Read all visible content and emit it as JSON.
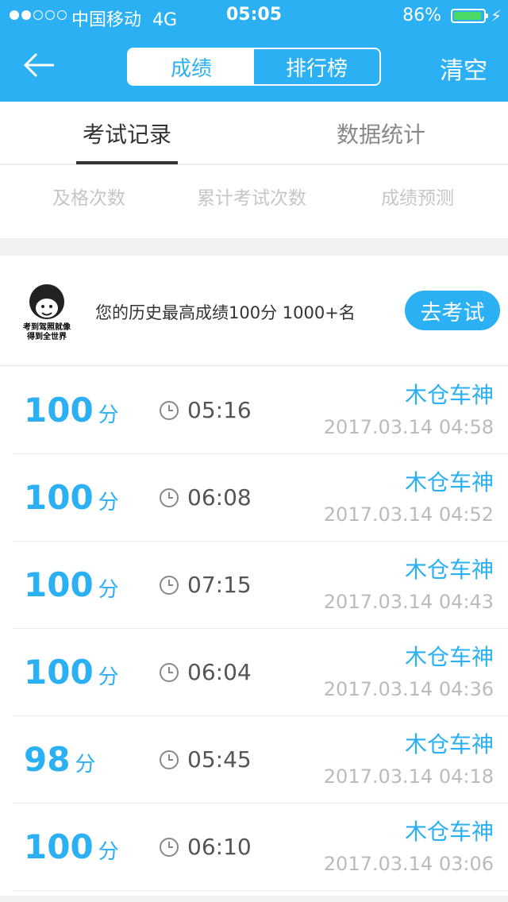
{
  "status_bar": {
    "carrier": "中国移动",
    "network": "4G",
    "time": "05:05",
    "battery_percent": "86%",
    "signal_strength": 2,
    "battery_level": 0.86,
    "battery_color": "#4cd964"
  },
  "header": {
    "back_icon": "arrow-left-icon",
    "segments": [
      "成绩",
      "排行榜"
    ],
    "active_segment": 0,
    "clear_label": "清空",
    "accent_color": "#2ab0f3"
  },
  "tabs": {
    "items": [
      "考试记录",
      "数据统计"
    ],
    "active": 0
  },
  "stats": {
    "labels": [
      "及格次数",
      "累计考试次数",
      "成绩预测"
    ]
  },
  "best": {
    "avatar_text": [
      "考到驾照就像",
      "得到全世界"
    ],
    "summary": "您的历史最高成绩100分  1000+名",
    "button_label": "去考试"
  },
  "records": [
    {
      "score": "100",
      "unit": "分",
      "duration": "05:16",
      "name": "木仓车神",
      "date": "2017.03.14 04:58"
    },
    {
      "score": "100",
      "unit": "分",
      "duration": "06:08",
      "name": "木仓车神",
      "date": "2017.03.14 04:52"
    },
    {
      "score": "100",
      "unit": "分",
      "duration": "07:15",
      "name": "木仓车神",
      "date": "2017.03.14 04:43"
    },
    {
      "score": "100",
      "unit": "分",
      "duration": "06:04",
      "name": "木仓车神",
      "date": "2017.03.14 04:36"
    },
    {
      "score": "98",
      "unit": "分",
      "duration": "05:45",
      "name": "木仓车神",
      "date": "2017.03.14 04:18"
    },
    {
      "score": "100",
      "unit": "分",
      "duration": "06:10",
      "name": "木仓车神",
      "date": "2017.03.14 03:06"
    }
  ]
}
